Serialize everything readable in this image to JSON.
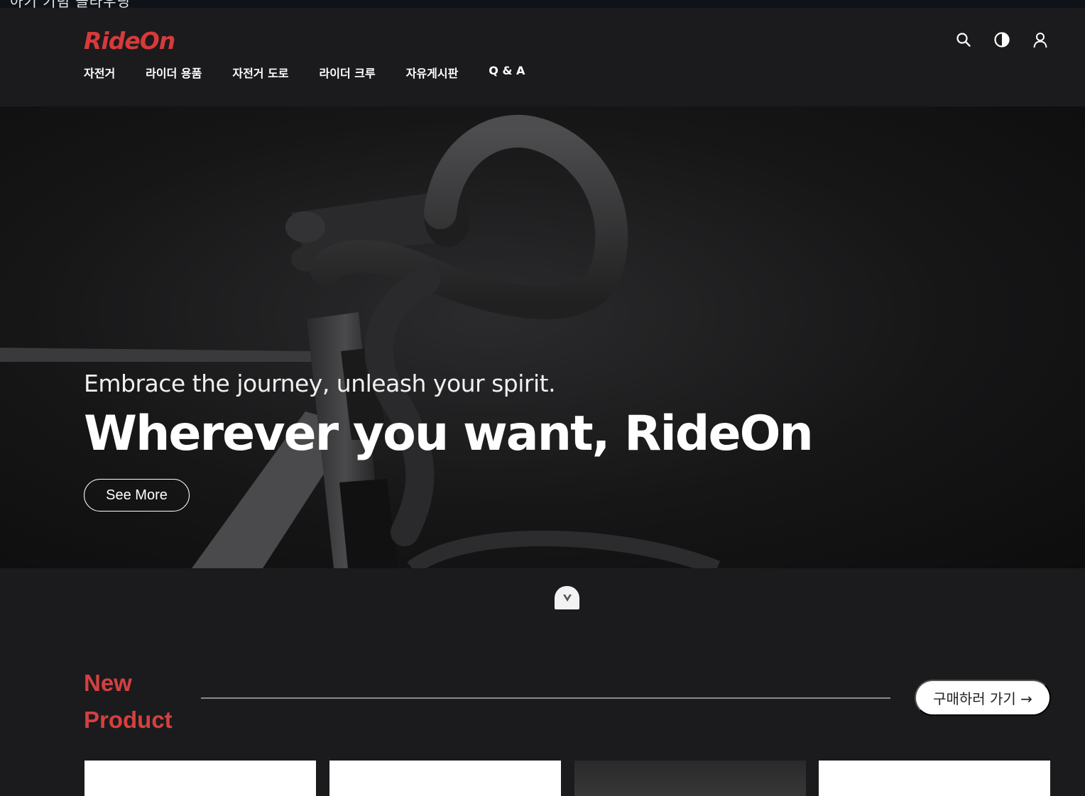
{
  "top_strip": {
    "text": "아기 기념 클라우딩"
  },
  "header": {
    "logo": "RideOn",
    "nav": [
      "자전거",
      "라이더 용품",
      "자전거 도로",
      "라이더 크루",
      "자유게시판",
      "Q & A"
    ],
    "icons": [
      "search-icon",
      "theme-toggle-icon",
      "user-icon"
    ]
  },
  "hero": {
    "subtitle": "Embrace the journey, unleash your spirit.",
    "title": "Wherever you want, RideOn",
    "button": "See More"
  },
  "scroll_indicator": {
    "icon": "chevron-down-icon"
  },
  "new_product": {
    "title_line1": "New",
    "title_line2": "Product",
    "button": "구매하러 가기 →"
  },
  "colors": {
    "accent": "#d54040",
    "background": "#1b1b1d"
  }
}
